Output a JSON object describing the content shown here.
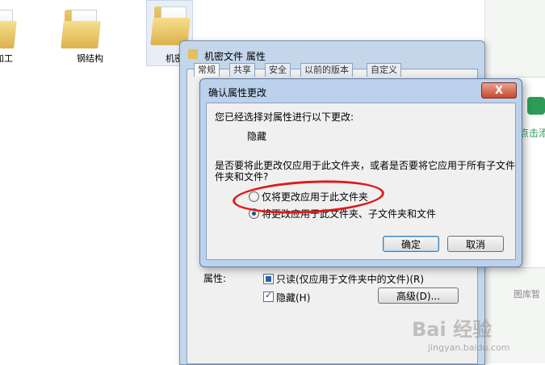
{
  "explorer": {
    "folders": [
      {
        "label": "加工"
      },
      {
        "label": "钢结构"
      },
      {
        "label": "机密"
      }
    ],
    "side_text_1": "点击添",
    "side_text_2": "图库暂"
  },
  "properties": {
    "title": "机密文件 属性",
    "tabs": [
      "常规",
      "共享",
      "安全",
      "以前的版本",
      "自定义"
    ],
    "attributes_label": "属性:",
    "readonly_label": "只读(仅应用于文件夹中的文件)(R)",
    "hidden_label": "隐藏(H)",
    "advanced_button": "高级(D)..."
  },
  "confirm": {
    "title": "确认属性更改",
    "close": "X",
    "intro": "您已经选择对属性进行以下更改:",
    "change": "隐藏",
    "question_line1": "是否要将此更改仅应用于此文件夹，或者是否要将它应用于所有子文件",
    "question_line2": "件夹和文件?",
    "option1": "仅将更改应用于此文件夹",
    "option2": "将更改应用于此文件夹、子文件夹和文件",
    "ok": "确定",
    "cancel": "取消"
  },
  "watermark": {
    "brand": "Bai 经验",
    "url": "jingyan.baidu.com"
  }
}
